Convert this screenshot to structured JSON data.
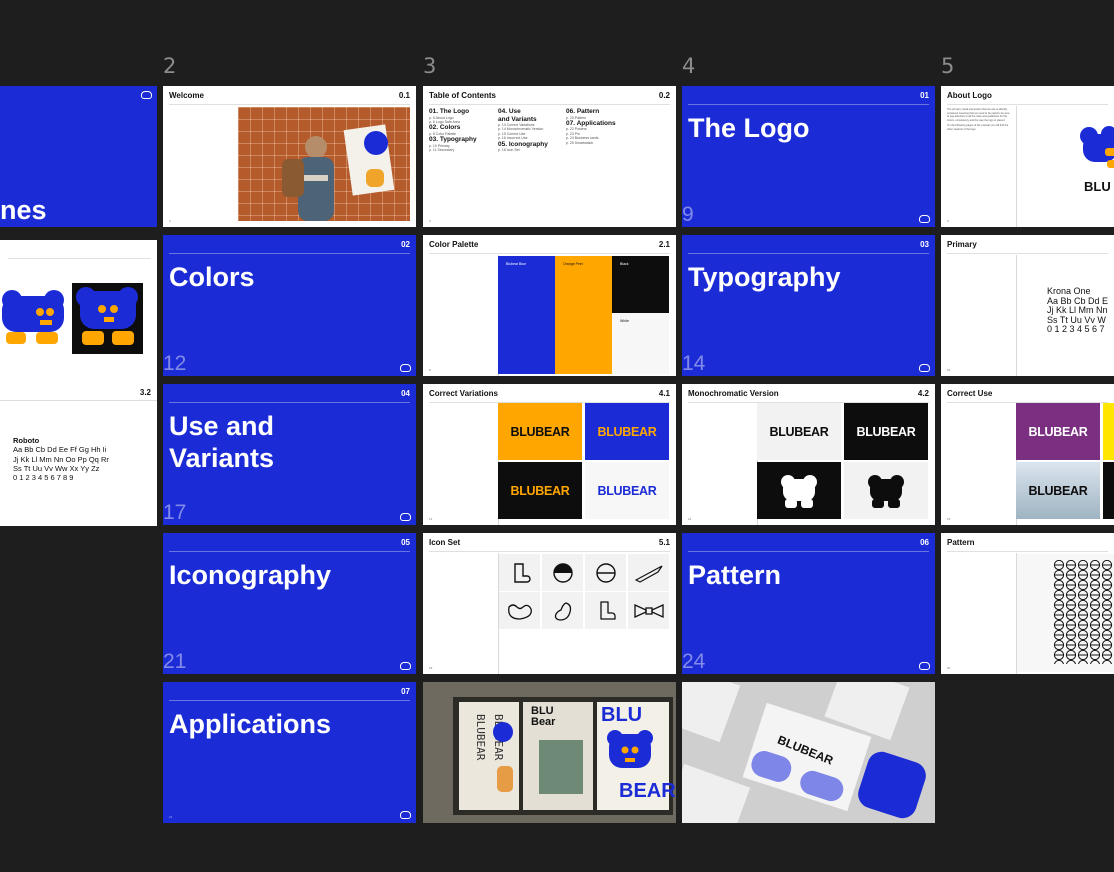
{
  "column_numbers": [
    "2",
    "3",
    "4",
    "5"
  ],
  "slides": {
    "r1_c0": {
      "title_frag": "nes"
    },
    "welcome": {
      "title": "Welcome",
      "num": "0.1",
      "page": "2"
    },
    "toc": {
      "title": "Table of Contents",
      "num": "0.2",
      "page": "3",
      "col1": {
        "h1": "01. The Logo",
        "s1": "p. 5 About Logo",
        "s1b": "p. 6 Logo Safe Area",
        "h2": "02. Colors",
        "s2": "p. 8 Color Palette",
        "h3": "03. Typography",
        "s3": "p. 10 Primary",
        "s3b": "p. 11 Secondary"
      },
      "col2": {
        "h1": "04. Use",
        "h1b": "and Variants",
        "s1": "p. 13 Correct Variations",
        "s1b": "p. 14 Monochromatic Version",
        "s1c": "p. 15 Correct Use",
        "s1d": "p. 16 Incorrect Use",
        "h2": "05. Iconography",
        "s2": "p. 18 Icon Set"
      },
      "col3": {
        "h1": "06. Pattern",
        "s1": "p. 20 Pattern",
        "h2": "07. Applications",
        "s2": "p. 22 Posters",
        "s2b": "p. 23 Pin",
        "s2c": "p. 24 Business cards",
        "s2d": "p. 25 Smartwatch"
      }
    },
    "the_logo": {
      "title": "The Logo",
      "num": "01",
      "bignum": "9"
    },
    "about_logo": {
      "title": "About Logo",
      "page": "5",
      "body1": "The primary visual expression that we use to identify ourselves meaning that we need to be careful, be sure to pay attention to all the rules and guidelines for the colors, consistency and the way the logo is placed.",
      "body2": "On the following pages of the manual you will find the other variants of the logo.",
      "wordmark_frag": "BLU"
    },
    "r2_c0": {
      "num": "3.2"
    },
    "colors": {
      "title": "Colors",
      "num": "02",
      "bignum": "12"
    },
    "color_palette": {
      "title": "Color Palette",
      "num": "2.1",
      "page": "8",
      "swatches": [
        {
          "label": "Blubear Blue",
          "color": "#1b2bd6"
        },
        {
          "label": "Orange Peel",
          "color": "#ffa600"
        },
        {
          "label": "Black",
          "color": "#0d0d0d"
        },
        {
          "label": "White",
          "color": "#f7f7f7"
        }
      ]
    },
    "typography": {
      "title": "Typography",
      "num": "03",
      "bignum": "14"
    },
    "primary": {
      "title": "Primary",
      "page": "10",
      "font_name": "Krona One",
      "line1": "Aa Bb Cb Dd E",
      "line2": "Jj Kk Ll Mm Nn",
      "line3": "Ss Tt Uu Vv W",
      "line4": "0 1 2 3 4 5 6 7"
    },
    "roboto": {
      "font_name": "Roboto",
      "line1": "Aa Bb Cb Dd Ee Ff Gg Hh Ii",
      "line2": "Jj Kk Ll Mm Nn Oo Pp Qq Rr",
      "line3": "Ss Tt Uu Vv Ww Xx Yy Zz",
      "line4": "0 1 2 3 4 5 6 7 8 9"
    },
    "use_variants": {
      "title1": "Use and",
      "title2": "Variants",
      "num": "04",
      "bignum": "17"
    },
    "correct_variations": {
      "title": "Correct Variations",
      "num": "4.1",
      "page": "13",
      "wordmark": "BLUBEAR"
    },
    "mono": {
      "title": "Monochromatic Version",
      "num": "4.2",
      "page": "14",
      "wordmark": "BLUBEAR"
    },
    "correct_use": {
      "title": "Correct Use",
      "page": "15",
      "wordmark": "BLUBEAR"
    },
    "iconography": {
      "title": "Iconography",
      "num": "05",
      "bignum": "21"
    },
    "icon_set": {
      "title": "Icon Set",
      "num": "5.1",
      "page": "18"
    },
    "pattern_title": {
      "title": "Pattern",
      "num": "06",
      "bignum": "24"
    },
    "pattern": {
      "title": "Pattern",
      "page": "20"
    },
    "applications": {
      "title": "Applications",
      "num": "07",
      "page": "21"
    },
    "poster": {
      "blu": "BLU",
      "bear": "BEAR",
      "blu2": "BLU",
      "bear2": "Bear"
    },
    "packaging": {
      "wordmark": "BLUBEAR"
    }
  },
  "colors": {
    "brand_blue": "#1b2bd6",
    "orange": "#ffa600",
    "black": "#0d0d0d",
    "background": "#1e1e1e"
  }
}
